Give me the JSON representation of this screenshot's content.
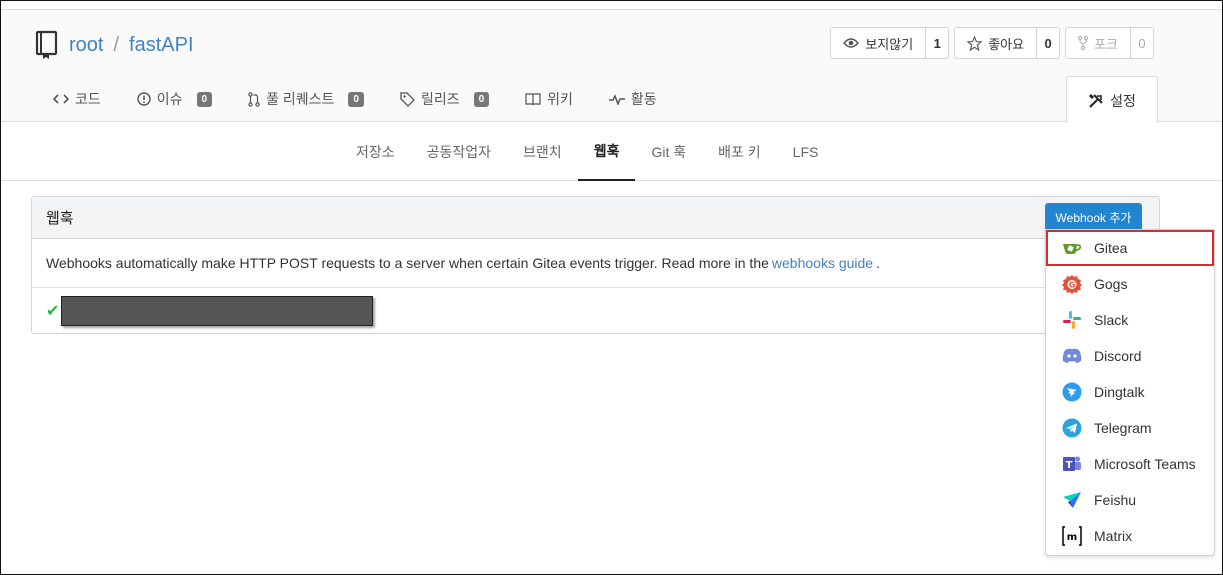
{
  "repo": {
    "owner": "root",
    "separator": "/",
    "name": "fastAPI"
  },
  "actions": [
    {
      "label": "보지않기",
      "count": "1",
      "icon": "eye-icon"
    },
    {
      "label": "좋아요",
      "count": "0",
      "icon": "star-icon"
    },
    {
      "label": "포크",
      "count": "0",
      "icon": "fork-icon",
      "disabled": true
    }
  ],
  "tabs": [
    {
      "label": "코드",
      "icon": "code-icon"
    },
    {
      "label": "이슈",
      "icon": "issue-icon",
      "badge": "0"
    },
    {
      "label": "풀 리퀘스트",
      "icon": "pull-request-icon",
      "badge": "0"
    },
    {
      "label": "릴리즈",
      "icon": "tag-icon",
      "badge": "0"
    },
    {
      "label": "위키",
      "icon": "book-icon"
    },
    {
      "label": "활동",
      "icon": "pulse-icon"
    }
  ],
  "settings_tab": {
    "label": "설정",
    "icon": "tools-icon"
  },
  "subnav": [
    "저장소",
    "공동작업자",
    "브랜치",
    "웹훅",
    "Git 훅",
    "배포 키",
    "LFS"
  ],
  "subnav_active": "웹훅",
  "panel": {
    "title": "웹훅",
    "add_button": "Webhook 추가",
    "desc_before": "Webhooks automatically make HTTP POST requests to a server when certain Gitea events trigger. Read more in the",
    "desc_link": "webhooks guide",
    "desc_after": "."
  },
  "webhook_types": [
    {
      "label": "Gitea",
      "icon": "gitea-icon",
      "highlighted": true
    },
    {
      "label": "Gogs",
      "icon": "gogs-icon"
    },
    {
      "label": "Slack",
      "icon": "slack-icon"
    },
    {
      "label": "Discord",
      "icon": "discord-icon"
    },
    {
      "label": "Dingtalk",
      "icon": "dingtalk-icon"
    },
    {
      "label": "Telegram",
      "icon": "telegram-icon"
    },
    {
      "label": "Microsoft Teams",
      "icon": "msteams-icon"
    },
    {
      "label": "Feishu",
      "icon": "feishu-icon"
    },
    {
      "label": "Matrix",
      "icon": "matrix-icon"
    }
  ],
  "colors": {
    "link": "#4183c4",
    "primary": "#2185d0",
    "success": "#21ba45",
    "highlight": "#d32f2f"
  }
}
